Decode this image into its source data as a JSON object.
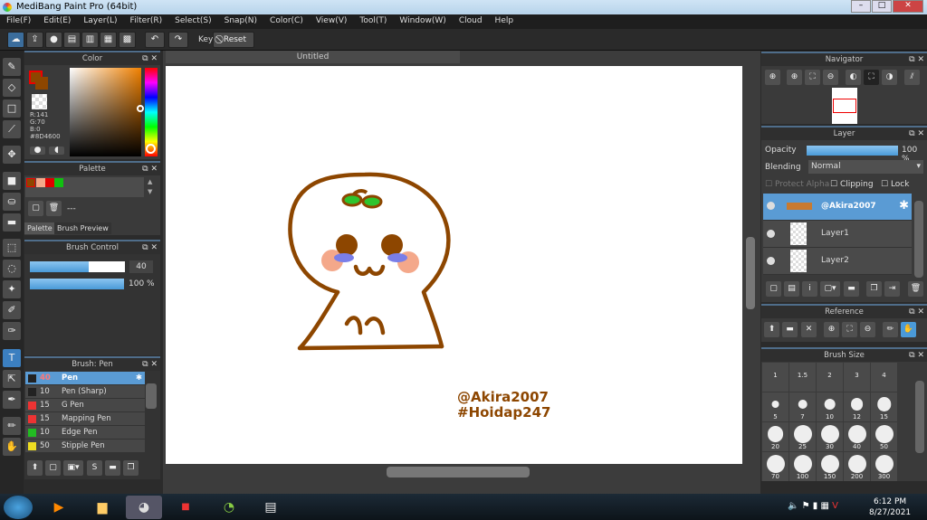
{
  "window": {
    "title": "MediBang Paint Pro (64bit)",
    "min": "–",
    "max": "□",
    "close": "✕"
  },
  "menu": [
    "File(F)",
    "Edit(E)",
    "Layer(L)",
    "Filter(R)",
    "Select(S)",
    "Snap(N)",
    "Color(C)",
    "View(V)",
    "Tool(T)",
    "Window(W)",
    "Cloud",
    "Help"
  ],
  "toolbar": {
    "key_label": "Key",
    "reset_label": "Reset"
  },
  "color": {
    "title": "Color",
    "r": "R:141",
    "g": "G:70",
    "b": "B:0",
    "hex": "#8D4600",
    "fg": "#8D4600",
    "bg": "#8D4600"
  },
  "palette": {
    "title": "Palette",
    "swatches": [
      "#8D4600",
      "#F4A88A",
      "#E00000",
      "#10C010"
    ],
    "name": "---",
    "tab_palette": "Palette",
    "tab_preview": "Brush Preview"
  },
  "brush_control": {
    "title": "Brush Control",
    "size": "40",
    "size_fraction": 0.62,
    "opacity": "100 %",
    "opacity_fraction": 1.0
  },
  "brush_list": {
    "title": "Brush: Pen",
    "items": [
      {
        "size": "40",
        "name": "Pen",
        "color": "#222222",
        "selected": true
      },
      {
        "size": "10",
        "name": "Pen (Sharp)",
        "color": "#222222"
      },
      {
        "size": "15",
        "name": "G Pen",
        "color": "#ee3333"
      },
      {
        "size": "15",
        "name": "Mapping Pen",
        "color": "#ee3333"
      },
      {
        "size": "10",
        "name": "Edge Pen",
        "color": "#22bb22"
      },
      {
        "size": "50",
        "name": "Stipple Pen",
        "color": "#eedd22"
      }
    ]
  },
  "canvas": {
    "tab": "Untitled",
    "signature_line1": "@Akira2007",
    "signature_line2": "#Hoidap247",
    "stroke_color": "#8D4600"
  },
  "navigator": {
    "title": "Navigator"
  },
  "layer": {
    "title": "Layer",
    "opacity_label": "Opacity",
    "opacity": "100 %",
    "blending_label": "Blending",
    "blending": "Normal",
    "protect_alpha": "Protect Alpha",
    "clipping": "Clipping",
    "lock": "Lock",
    "layers": [
      {
        "name": "@Akira2007",
        "selected": true
      },
      {
        "name": "Layer1"
      },
      {
        "name": "Layer2"
      }
    ]
  },
  "reference": {
    "title": "Reference"
  },
  "brush_size": {
    "title": "Brush Size",
    "sizes": [
      "1",
      "1.5",
      "2",
      "3",
      "4",
      "5",
      "7",
      "10",
      "12",
      "15",
      "20",
      "25",
      "30",
      "40",
      "50",
      "70",
      "100",
      "150",
      "200",
      "300"
    ]
  },
  "taskbar": {
    "time": "6:12 PM",
    "date": "8/27/2021"
  }
}
